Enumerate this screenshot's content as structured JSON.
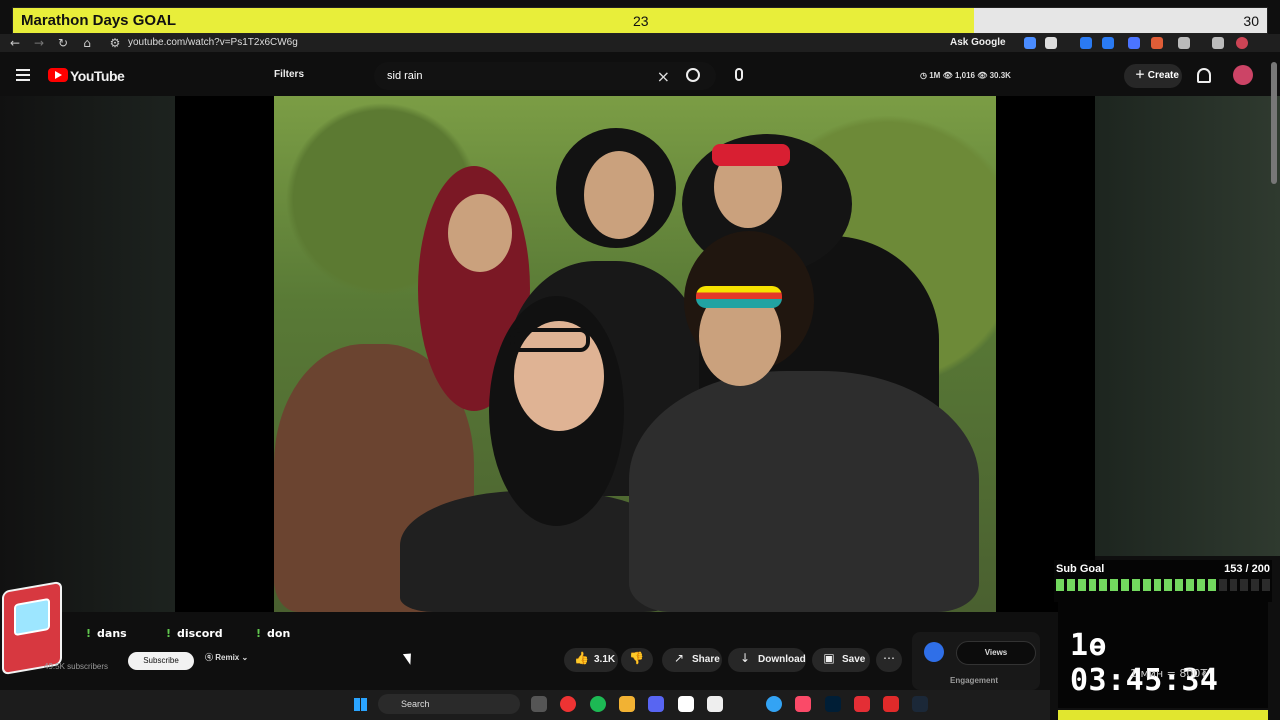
{
  "goal": {
    "title": "Marathon Days GOAL",
    "current": "23",
    "target": "30",
    "progress": 0.7667
  },
  "browser": {
    "url": "youtube.com/watch?v=Ps1T2x6CW6g",
    "ask_google": "Ask Google"
  },
  "youtube": {
    "logo_text": "YouTube",
    "filters": "Filters",
    "search_query": "sid rain",
    "stats": {
      "one": "1M",
      "two": "1,016",
      "three": "30.3K"
    },
    "create": "Create"
  },
  "video": {
    "description": "Group photo of five people in rock-themed outfits outdoors"
  },
  "channel": {
    "subscribers": "49.5K subscribers",
    "subscribe": "Subscribe",
    "remix": "Remix"
  },
  "chat_commands": [
    "dans",
    "discord",
    "don"
  ],
  "actions": {
    "likes": "3.1K",
    "share": "Share",
    "download": "Download",
    "save": "Save"
  },
  "panel": {
    "views": "Views",
    "engagement": "Engagement"
  },
  "subgoal": {
    "title": "Sub Goal",
    "count": "153 / 200",
    "filled_segments": 15,
    "total_segments": 20
  },
  "timer": {
    "value": "1ө 03:45:34",
    "rate": "1 мин = 800₮"
  },
  "taskbar": {
    "search": "Search"
  },
  "colors": {
    "goal_fill": "#e8ee3a",
    "youtube_red": "#ff0000",
    "subgoal_green": "#73d95f"
  }
}
